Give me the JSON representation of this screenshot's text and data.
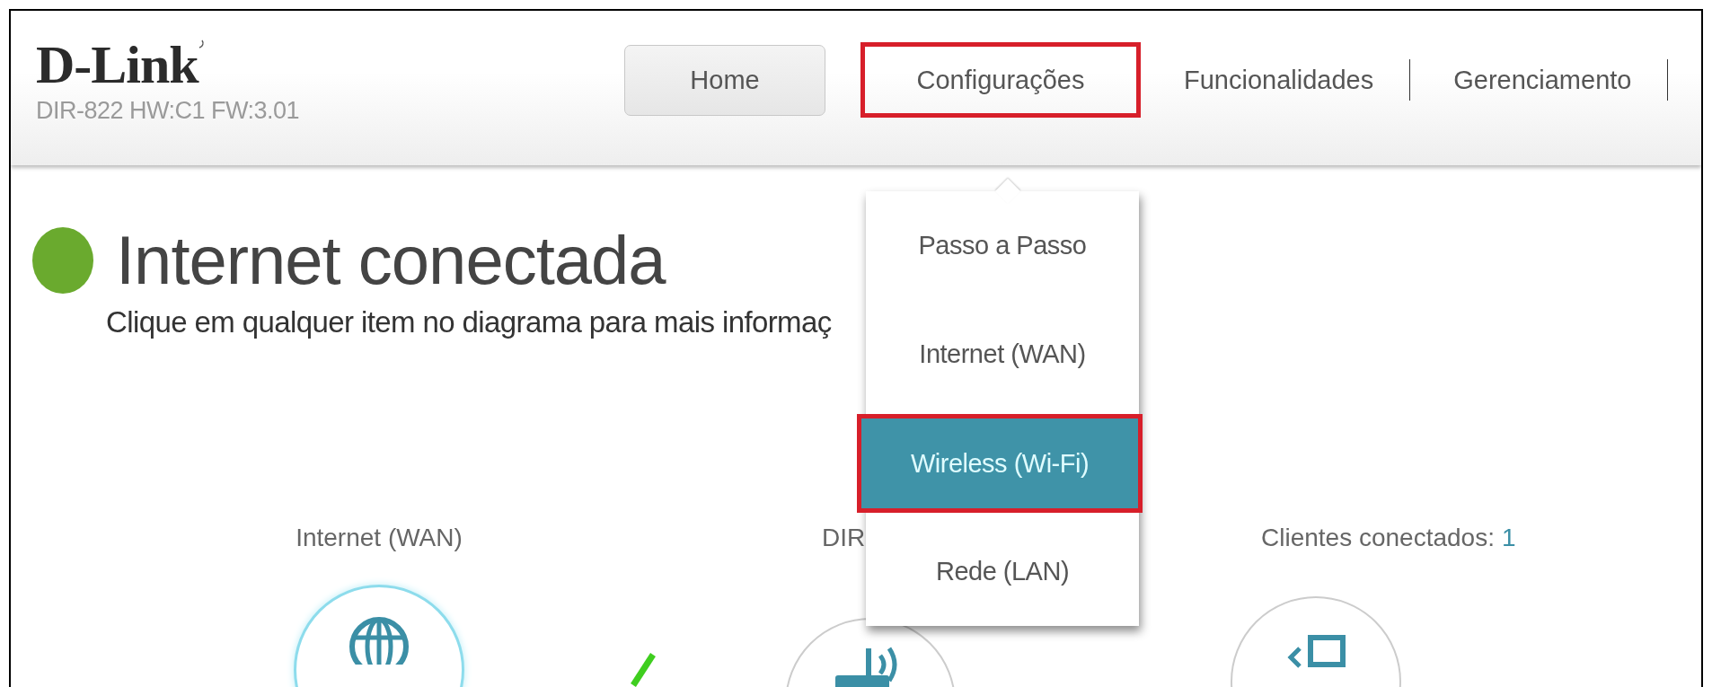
{
  "header": {
    "logo": "D-Link",
    "model": "DIR-822 HW:C1 FW:3.01"
  },
  "nav": [
    {
      "label": "Home",
      "kind": "button",
      "highlighted": false
    },
    {
      "label": "Configurações",
      "kind": "link",
      "highlighted": true
    },
    {
      "label": "Funcionalidades",
      "kind": "link",
      "highlighted": false
    },
    {
      "label": "Gerenciamento",
      "kind": "link",
      "highlighted": false
    }
  ],
  "menu": {
    "items": [
      {
        "label": "Passo a Passo",
        "selected": false,
        "highlighted": false
      },
      {
        "label": "Internet (WAN)",
        "selected": false,
        "highlighted": false
      },
      {
        "label": "Wireless (Wi-Fi)",
        "selected": true,
        "highlighted": true
      },
      {
        "label": "Rede (LAN)",
        "selected": false,
        "highlighted": false
      }
    ]
  },
  "status": {
    "connected": true,
    "title": "Internet conectada",
    "message": "Clique em qualquer item no diagrama para mais informaç"
  },
  "diagram": [
    {
      "kind": "internet",
      "label": "Internet (WAN)"
    },
    {
      "kind": "router",
      "label": "DIR"
    },
    {
      "kind": "clients",
      "label": "Clientes conectados:",
      "count": "1"
    }
  ]
}
